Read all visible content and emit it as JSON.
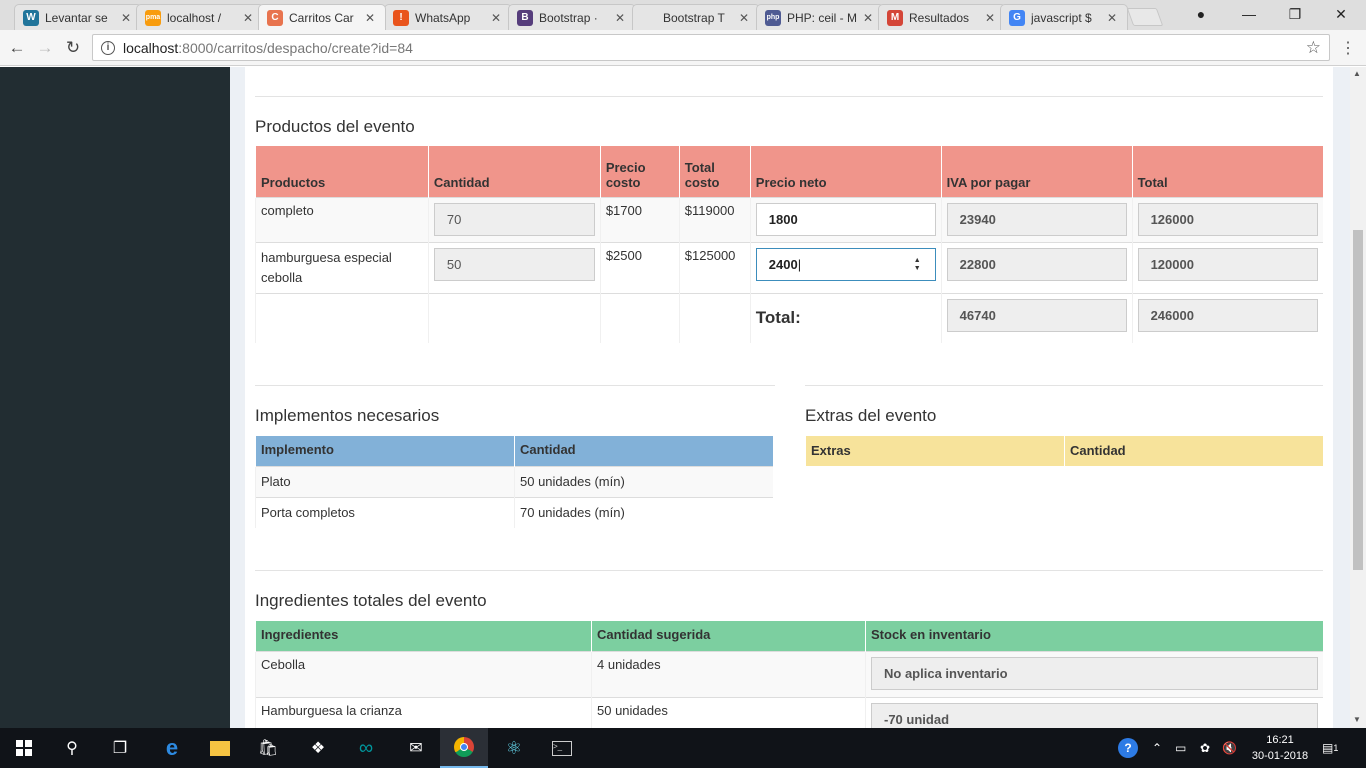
{
  "browser": {
    "tabs": [
      {
        "title": "Levantar se",
        "icon": "wordpress-icon",
        "color": "#21759b",
        "glyph": "W"
      },
      {
        "title": "localhost / ",
        "icon": "phpmyadmin-icon",
        "color": "#f89c0e",
        "glyph": "pma"
      },
      {
        "title": "Carritos Car",
        "icon": "carritos-favicon",
        "color": "#e8744f",
        "glyph": "C"
      },
      {
        "title": "WhatsApp",
        "icon": "whatsapp-error-icon",
        "color": "#e9541c",
        "glyph": "!"
      },
      {
        "title": "Bootstrap ·",
        "icon": "bootstrap-icon",
        "color": "#563d7c",
        "glyph": "B"
      },
      {
        "title": "Bootstrap T",
        "icon": "blank-page-icon",
        "color": "#e5e5e5",
        "glyph": ""
      },
      {
        "title": "PHP: ceil - M",
        "icon": "php-icon",
        "color": "#4f5b93",
        "glyph": "php"
      },
      {
        "title": "Resultados",
        "icon": "gmail-icon",
        "color": "#d44638",
        "glyph": "M"
      },
      {
        "title": "javascript $",
        "icon": "google-icon",
        "color": "#4285f4",
        "glyph": "G"
      }
    ],
    "active_tab": 2,
    "url_host": "localhost",
    "url_path": ":8000/carritos/despacho/create?id=84"
  },
  "productos": {
    "title": "Productos del evento",
    "headers": [
      "Productos",
      "Cantidad",
      "Precio costo",
      "Total costo",
      "Precio neto",
      "IVA por pagar",
      "Total"
    ],
    "rows": [
      {
        "producto": "completo",
        "cantidad": "70",
        "precio_costo": "$1700",
        "total_costo": "$119000",
        "precio_neto": "1800",
        "iva": "23940",
        "total": "126000"
      },
      {
        "producto": "hamburguesa especial cebolla",
        "cantidad": "50",
        "precio_costo": "$2500",
        "total_costo": "$125000",
        "precio_neto": "2400",
        "iva": "22800",
        "total": "120000"
      }
    ],
    "total_label": "Total:",
    "total_iva": "46740",
    "total_total": "246000"
  },
  "implementos": {
    "title": "Implementos necesarios",
    "headers": [
      "Implemento",
      "Cantidad"
    ],
    "rows": [
      {
        "nombre": "Plato",
        "cantidad": "50 unidades (mín)"
      },
      {
        "nombre": "Porta completos",
        "cantidad": "70 unidades (mín)"
      }
    ]
  },
  "extras": {
    "title": "Extras del evento",
    "headers": [
      "Extras",
      "Cantidad"
    ]
  },
  "ingredientes": {
    "title": "Ingredientes totales del evento",
    "headers": [
      "Ingredientes",
      "Cantidad sugerida",
      "Stock en inventario"
    ],
    "rows": [
      {
        "nombre": "Cebolla",
        "cantidad": "4 unidades",
        "stock": "No aplica inventario"
      },
      {
        "nombre": "Hamburguesa la crianza",
        "cantidad": "50 unidades",
        "stock": "-70 unidad"
      }
    ]
  },
  "taskbar": {
    "time": "16:21",
    "date": "30-01-2018",
    "notifications": "1"
  },
  "colors": {
    "productos_header": "#f0958b",
    "implementos_header": "#82b1d8",
    "extras_header": "#f7e39b",
    "ingredientes_header": "#7ccfa0",
    "sidebar": "#222d32"
  }
}
